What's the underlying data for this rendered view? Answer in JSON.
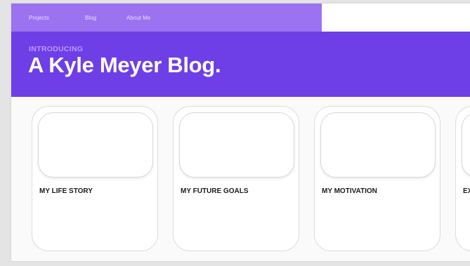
{
  "nav": {
    "items": [
      "Projects",
      "Blog",
      "About Me"
    ]
  },
  "hero": {
    "kicker": "INTRODUCING",
    "title": "A Kyle Meyer Blog."
  },
  "cards": [
    {
      "label": "MY LIFE STORY"
    },
    {
      "label": "MY FUTURE GOALS"
    },
    {
      "label": "MY MOTIVATION"
    },
    {
      "label": "EX"
    }
  ],
  "colors": {
    "nav_bg": "#9b72ef",
    "hero_bg": "#6e3fe6",
    "kicker": "#b999ff",
    "title": "#ffffff"
  }
}
